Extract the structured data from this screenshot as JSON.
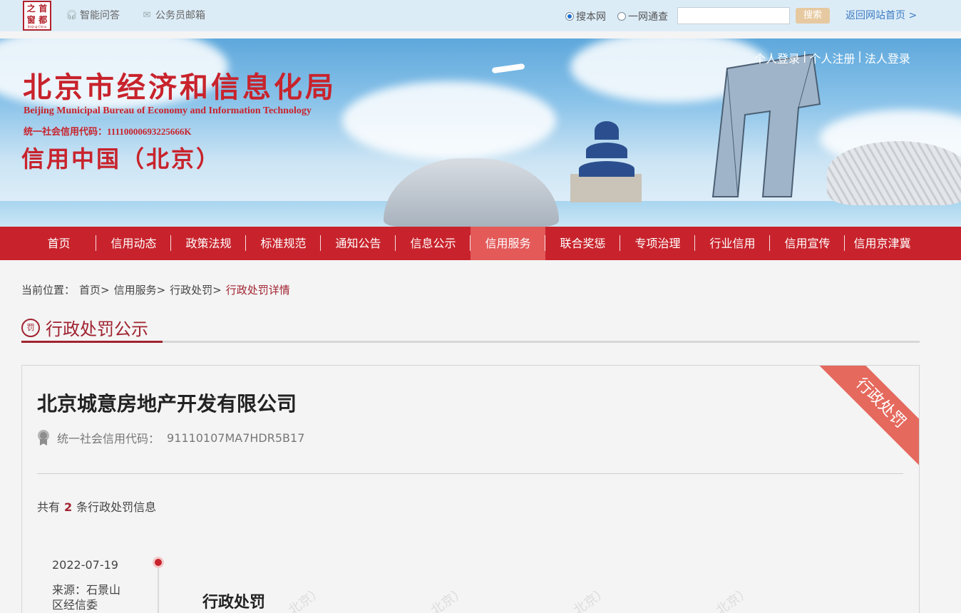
{
  "topbar": {
    "logo_chars": [
      "首",
      "之",
      "都",
      "窗"
    ],
    "logo_tiny": "Beijing-China",
    "qa_label": "智能问答",
    "mail_label": "公务员邮箱",
    "radio_site": "搜本网",
    "radio_all": "一网通查",
    "search_value": "",
    "search_button": "搜索",
    "return_label": "返回网站首页 >"
  },
  "banner": {
    "org_cn": "北京市经济和信息化局",
    "org_en": "Beijing Municipal Bureau of Economy and Information Technology",
    "org_code": "统一社会信用代码：11110000693225666K",
    "sub_title": "信用中国（北京）",
    "login_personal": "个人登录",
    "login_register": "个人注册",
    "login_legal": "法人登录",
    "separator": "|"
  },
  "nav": {
    "items": [
      "首页",
      "信用动态",
      "政策法规",
      "标准规范",
      "通知公告",
      "信息公示",
      "信用服务",
      "联合奖惩",
      "专项治理",
      "行业信用",
      "信用宣传",
      "信用京津冀"
    ],
    "active_index": 6
  },
  "breadcrumb": {
    "prefix": "当前位置：",
    "home": "首页>",
    "level1": "信用服务>",
    "level2": "行政处罚>",
    "current": "行政处罚详情"
  },
  "section": {
    "icon_text": "罚",
    "title": "行政处罚公示"
  },
  "card": {
    "company": "北京城意房地产开发有限公司",
    "code_label": "统一社会信用代码：",
    "code_value": "91110107MA7HDR5B17",
    "count_prefix": "共有",
    "count_value": "2",
    "count_suffix": "条行政处罚信息",
    "ribbon": "行政处罚",
    "record": {
      "date": "2022-07-19",
      "source": "来源：石景山区经信委",
      "title": "行政处罚"
    },
    "watermark": "北京）"
  },
  "colors": {
    "brand_red": "#c8232c",
    "accent_dark_red": "#a02330",
    "nav_active": "#e35a59",
    "ribbon": "#e5695d",
    "link_blue": "#3e7cc2"
  }
}
